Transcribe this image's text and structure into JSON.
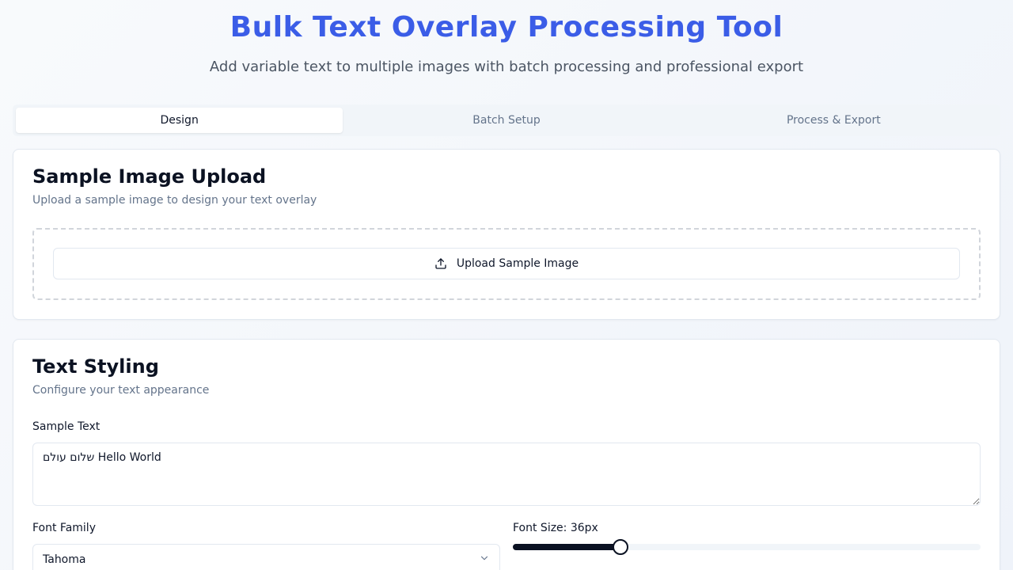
{
  "header": {
    "title": "Bulk Text Overlay Processing Tool",
    "subtitle": "Add variable text to multiple images with batch processing and professional export"
  },
  "tabs": [
    {
      "label": "Design",
      "active": true
    },
    {
      "label": "Batch Setup",
      "active": false
    },
    {
      "label": "Process & Export",
      "active": false
    }
  ],
  "upload_card": {
    "title": "Sample Image Upload",
    "description": "Upload a sample image to design your text overlay",
    "upload_button_label": "Upload Sample Image",
    "upload_icon": "upload-icon"
  },
  "styling_card": {
    "title": "Text Styling",
    "description": "Configure your text appearance",
    "sample_text_label": "Sample Text",
    "sample_text_value": "שלום עולם Hello World",
    "font_family_label": "Font Family",
    "font_family_value": "Tahoma",
    "font_size_label": "Font Size: 36px",
    "font_size_value": 36,
    "font_size_fraction": 0.23
  },
  "colors": {
    "accent": "#3b5de7",
    "slider": "#0b1222"
  }
}
